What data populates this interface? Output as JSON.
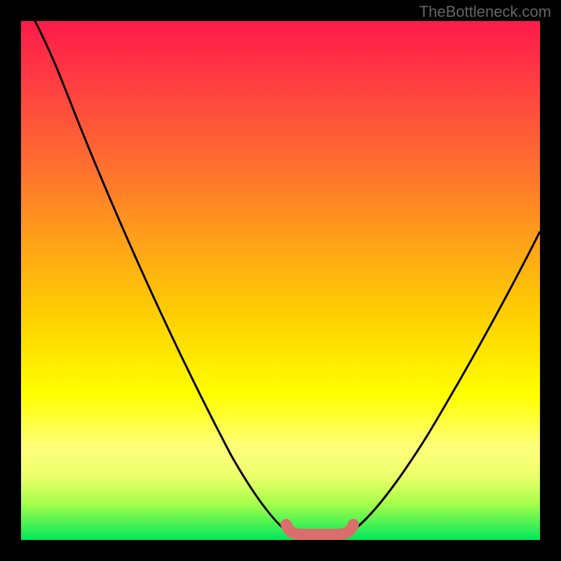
{
  "watermark": "TheBottleneck.com",
  "chart_data": {
    "type": "line",
    "title": "",
    "xlabel": "",
    "ylabel": "",
    "xlim": [
      0,
      100
    ],
    "ylim": [
      0,
      100
    ],
    "curve_left": {
      "x": [
        3,
        8,
        15,
        25,
        35,
        45,
        52
      ],
      "y": [
        100,
        88,
        72,
        50,
        28,
        6,
        0
      ]
    },
    "curve_right": {
      "x": [
        62,
        70,
        80,
        90,
        100
      ],
      "y": [
        0,
        14,
        32,
        48,
        60
      ]
    },
    "highlight_zone": {
      "x": [
        51,
        63
      ],
      "y_level": 1.5,
      "color": "#db6d6d"
    },
    "gradient_stops": [
      {
        "pos": 0,
        "color": "#ff1a4a"
      },
      {
        "pos": 12,
        "color": "#ff3e42"
      },
      {
        "pos": 28,
        "color": "#ff6f2f"
      },
      {
        "pos": 42,
        "color": "#ffa019"
      },
      {
        "pos": 58,
        "color": "#ffd300"
      },
      {
        "pos": 72,
        "color": "#ffff00"
      },
      {
        "pos": 82,
        "color": "#ffff7a"
      },
      {
        "pos": 88,
        "color": "#eaff6a"
      },
      {
        "pos": 93,
        "color": "#a6ff4a"
      },
      {
        "pos": 100,
        "color": "#00e85a"
      }
    ]
  }
}
